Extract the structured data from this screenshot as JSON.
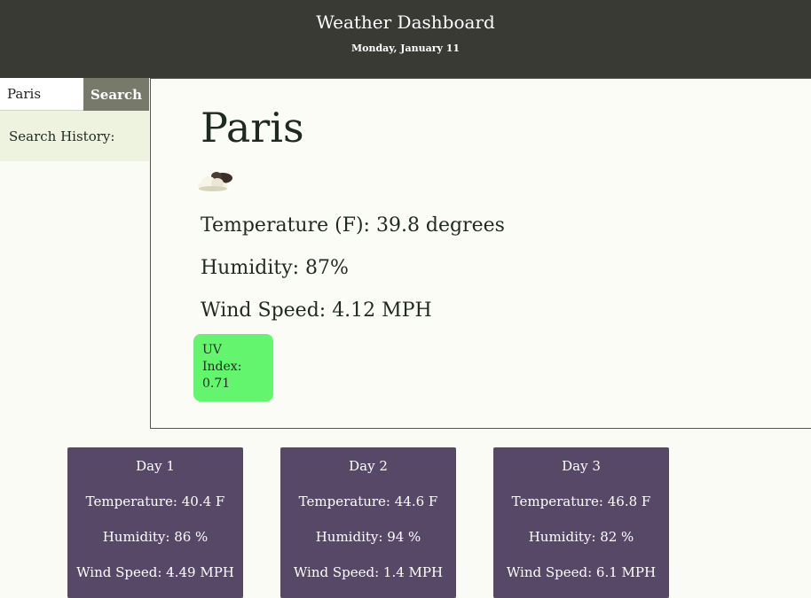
{
  "header": {
    "title": "Weather Dashboard",
    "date": "Monday, January 11"
  },
  "search": {
    "value": "Paris",
    "button_label": "Search",
    "history_label": "Search History:"
  },
  "current": {
    "city": "Paris",
    "icon": "cloudy-icon",
    "temperature": "Temperature (F): 39.8 degrees",
    "humidity": "Humidity: 87%",
    "wind": "Wind Speed: 4.12 MPH",
    "uv_label": "UV Index:",
    "uv_value": "0.71",
    "uv_color": "#64f56f"
  },
  "forecast": [
    {
      "day": "Day 1",
      "temp": "Temperature: 40.4 F",
      "humidity": "Humidity: 86 %",
      "wind": "Wind Speed: 4.49 MPH"
    },
    {
      "day": "Day 2",
      "temp": "Temperature: 44.6 F",
      "humidity": "Humidity: 94 %",
      "wind": "Wind Speed: 1.4 MPH"
    },
    {
      "day": "Day 3",
      "temp": "Temperature: 46.8 F",
      "humidity": "Humidity: 82 %",
      "wind": "Wind Speed: 6.1 MPH"
    }
  ],
  "colors": {
    "header_bg": "#3a3a35",
    "forecast_bg": "#574868",
    "uv_green": "#64f56f"
  }
}
